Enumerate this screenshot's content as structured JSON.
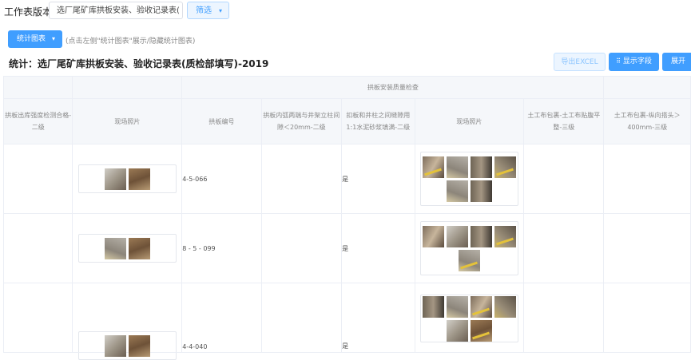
{
  "topbar": {
    "version_label": "工作表版本:",
    "version_value": "选厂尾矿库拱板安装、验收记录表(",
    "filter_label": "筛选"
  },
  "toolbar": {
    "stat_label": "统计图表",
    "hint": "(点击左侧\"统计图表\"展示/隐藏统计图表)",
    "export_label": "导出EXCEL",
    "fields_label": "显示字段",
    "expand_label": "展开"
  },
  "page_title": "统计：选厂尾矿库拱板安装、验收记录表(质检部填写)-2019",
  "table": {
    "group_header": "拱板安装质量检查",
    "columns": [
      "拱板出库强度检测合格-二级",
      "现场照片",
      "拱板编号",
      "拱板内弧两端与井架立柱间隙＜20mm-二级",
      "扣板和井柱之间缝隙用1:1水泥砂浆填满-二级",
      "现场照片",
      "土工布包裹-土工布贴腹平整-三级",
      "土工布包裹-纵向搭头＞400mm-三级"
    ],
    "rows": [
      {
        "number": "4-5-066",
        "filled": "是"
      },
      {
        "number": "8 - 5 - 099",
        "filled": "是"
      },
      {
        "number": "4-4-040",
        "filled": "是"
      }
    ]
  },
  "colors": {
    "primary": "#409eff",
    "header_bg": "#f5f7fa"
  }
}
